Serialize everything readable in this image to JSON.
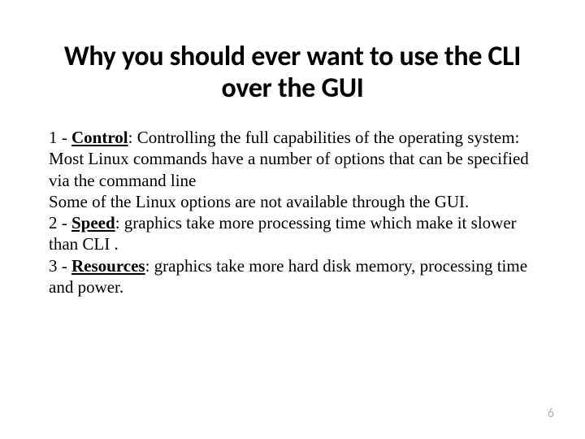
{
  "title": "Why you should ever want to use the CLI over the GUI",
  "items": [
    {
      "prefix": "1 - ",
      "label": "Control",
      "text": ": Controlling the full capabilities of the operating system:"
    },
    {
      "prefix": "",
      "label": "",
      "text": "Most Linux commands have a number of options that can be specified via the command line"
    },
    {
      "prefix": "",
      "label": "",
      "text": "Some of the Linux options are not available through the GUI."
    },
    {
      "prefix": "2 - ",
      "label": "Speed",
      "text": ": graphics take more processing time which make it slower than CLI ."
    },
    {
      "prefix": "3 - ",
      "label": "Resources",
      "text": ": graphics take more hard disk memory, processing time and power."
    }
  ],
  "page_number": "6"
}
